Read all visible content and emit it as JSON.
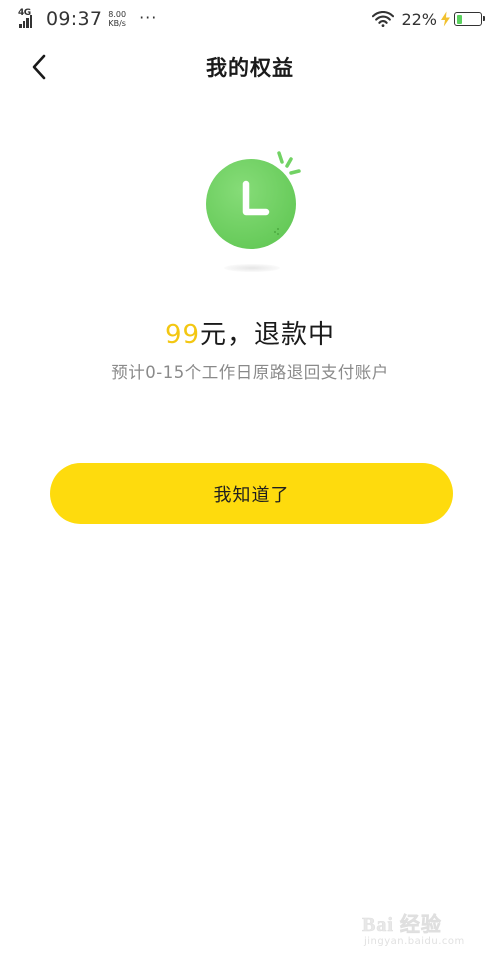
{
  "status_bar": {
    "network": "4G",
    "time": "09:37",
    "speed_value": "8.00",
    "speed_unit": "KB/s",
    "more": "···",
    "battery_percent": "22%",
    "battery_level": 0.22,
    "battery_color": "#5bd15f",
    "charging_color": "#f2c12e",
    "wifi_icon": "wifi-icon",
    "charging_icon": "lightning-icon",
    "battery_icon": "battery-icon"
  },
  "nav": {
    "back_icon": "chevron-left-icon",
    "title": "我的权益"
  },
  "illustration": {
    "icon": "clock-icon",
    "clock_color": "#72d264",
    "sparkle_color": "#72d264"
  },
  "refund": {
    "amount": "99",
    "status": "元，退款中",
    "amount_color": "#f3c712",
    "note": "预计0-15个工作日原路退回支付账户"
  },
  "confirm_button": {
    "label": "我知道了",
    "color": "#fedb0d"
  },
  "watermark": {
    "logo_text": "Bai 经验",
    "sub_text": "jingyan.baidu.com"
  }
}
